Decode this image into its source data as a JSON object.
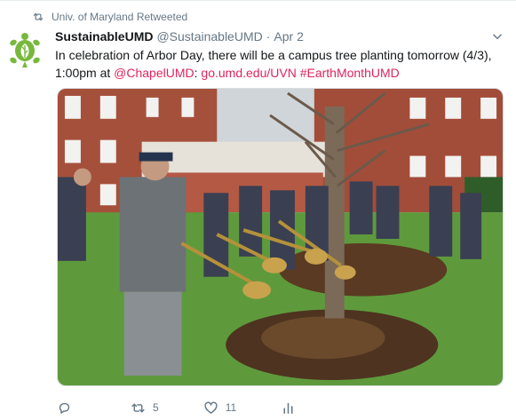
{
  "retweet": {
    "label": "Univ. of Maryland Retweeted",
    "icon": "retweet-icon"
  },
  "author": {
    "name": "SustainableUMD",
    "handle": "@SustainableUMD",
    "separator": "·",
    "date": "Apr 2",
    "avatar_icon": "turtle-logo-icon"
  },
  "text": {
    "part1": "In celebration of Arbor Day, there will be a campus tree planting tomorrow (4/3), 1:00pm at ",
    "mention": "@ChapelUMD",
    "part2": ": ",
    "url": "go.umd.edu/UVN",
    "part3": " ",
    "hashtag": "#EarthMonthUMD"
  },
  "media": {
    "description_icon": "tree-planting-photo"
  },
  "actions": {
    "reply_count": "",
    "retweet_count": "5",
    "like_count": "11"
  },
  "colors": {
    "accent": "#e0245e",
    "muted": "#657786",
    "text": "#14171a",
    "avatar_green": "#78b83c"
  }
}
